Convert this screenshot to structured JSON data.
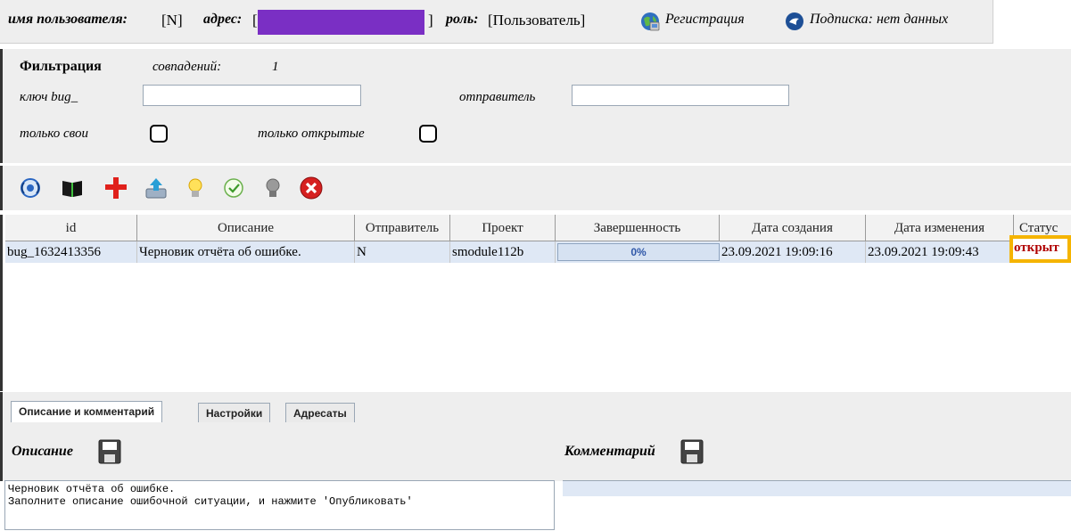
{
  "userbar": {
    "username_label": "имя пользователя:",
    "username_value": "[N]",
    "address_label": "адрес:",
    "address_open": "[",
    "address_close": "]",
    "role_label": "роль:",
    "role_value": "[Пользователь]",
    "register_link": "Регистрация",
    "subscription_text": "Подписка: нет данных",
    "icons": [
      "globe-icon",
      "subscription-icon"
    ]
  },
  "filter": {
    "title": "Фильтрация",
    "matches_label": "совпадений:",
    "matches_value": "1",
    "bug_key_label": "ключ bug_",
    "bug_key_value": "",
    "sender_label": "отправитель",
    "sender_value": "",
    "only_mine_label": "только свои",
    "only_mine_checked": false,
    "only_open_label": "только открытые",
    "only_open_checked": false
  },
  "toolbar": {
    "buttons": [
      "refresh-icon",
      "open-book-icon",
      "add-icon",
      "upload-icon",
      "bulb-on-icon",
      "check-icon",
      "bulb-off-icon",
      "delete-icon"
    ]
  },
  "table": {
    "columns": [
      "id",
      "Описание",
      "Отправитель",
      "Проект",
      "Завершенность",
      "Дата создания",
      "Дата изменения",
      "Статус"
    ],
    "rows": [
      {
        "id": "bug_1632413356",
        "description": "Черновик отчёта об ошибке.",
        "sender": "N",
        "project": "smodule112b",
        "completeness": "0%",
        "created": "23.09.2021 19:09:16",
        "modified": "23.09.2021 19:09:43",
        "status": "открыт"
      }
    ]
  },
  "tabs": [
    "Описание и комментарий",
    "Настройки",
    "Адресаты"
  ],
  "description_panel": {
    "title": "Описание",
    "text": "Черновик отчёта об ошибке.\nЗаполните описание ошибочной ситуации, и нажмите 'Опубликовать'"
  },
  "comment_panel": {
    "title": "Комментарий",
    "text": ""
  },
  "colors": {
    "accent_highlight": "#f5b400",
    "status_color": "#b00000",
    "selected_row": "#dfe8f5",
    "redaction": "#7a2fc4"
  }
}
